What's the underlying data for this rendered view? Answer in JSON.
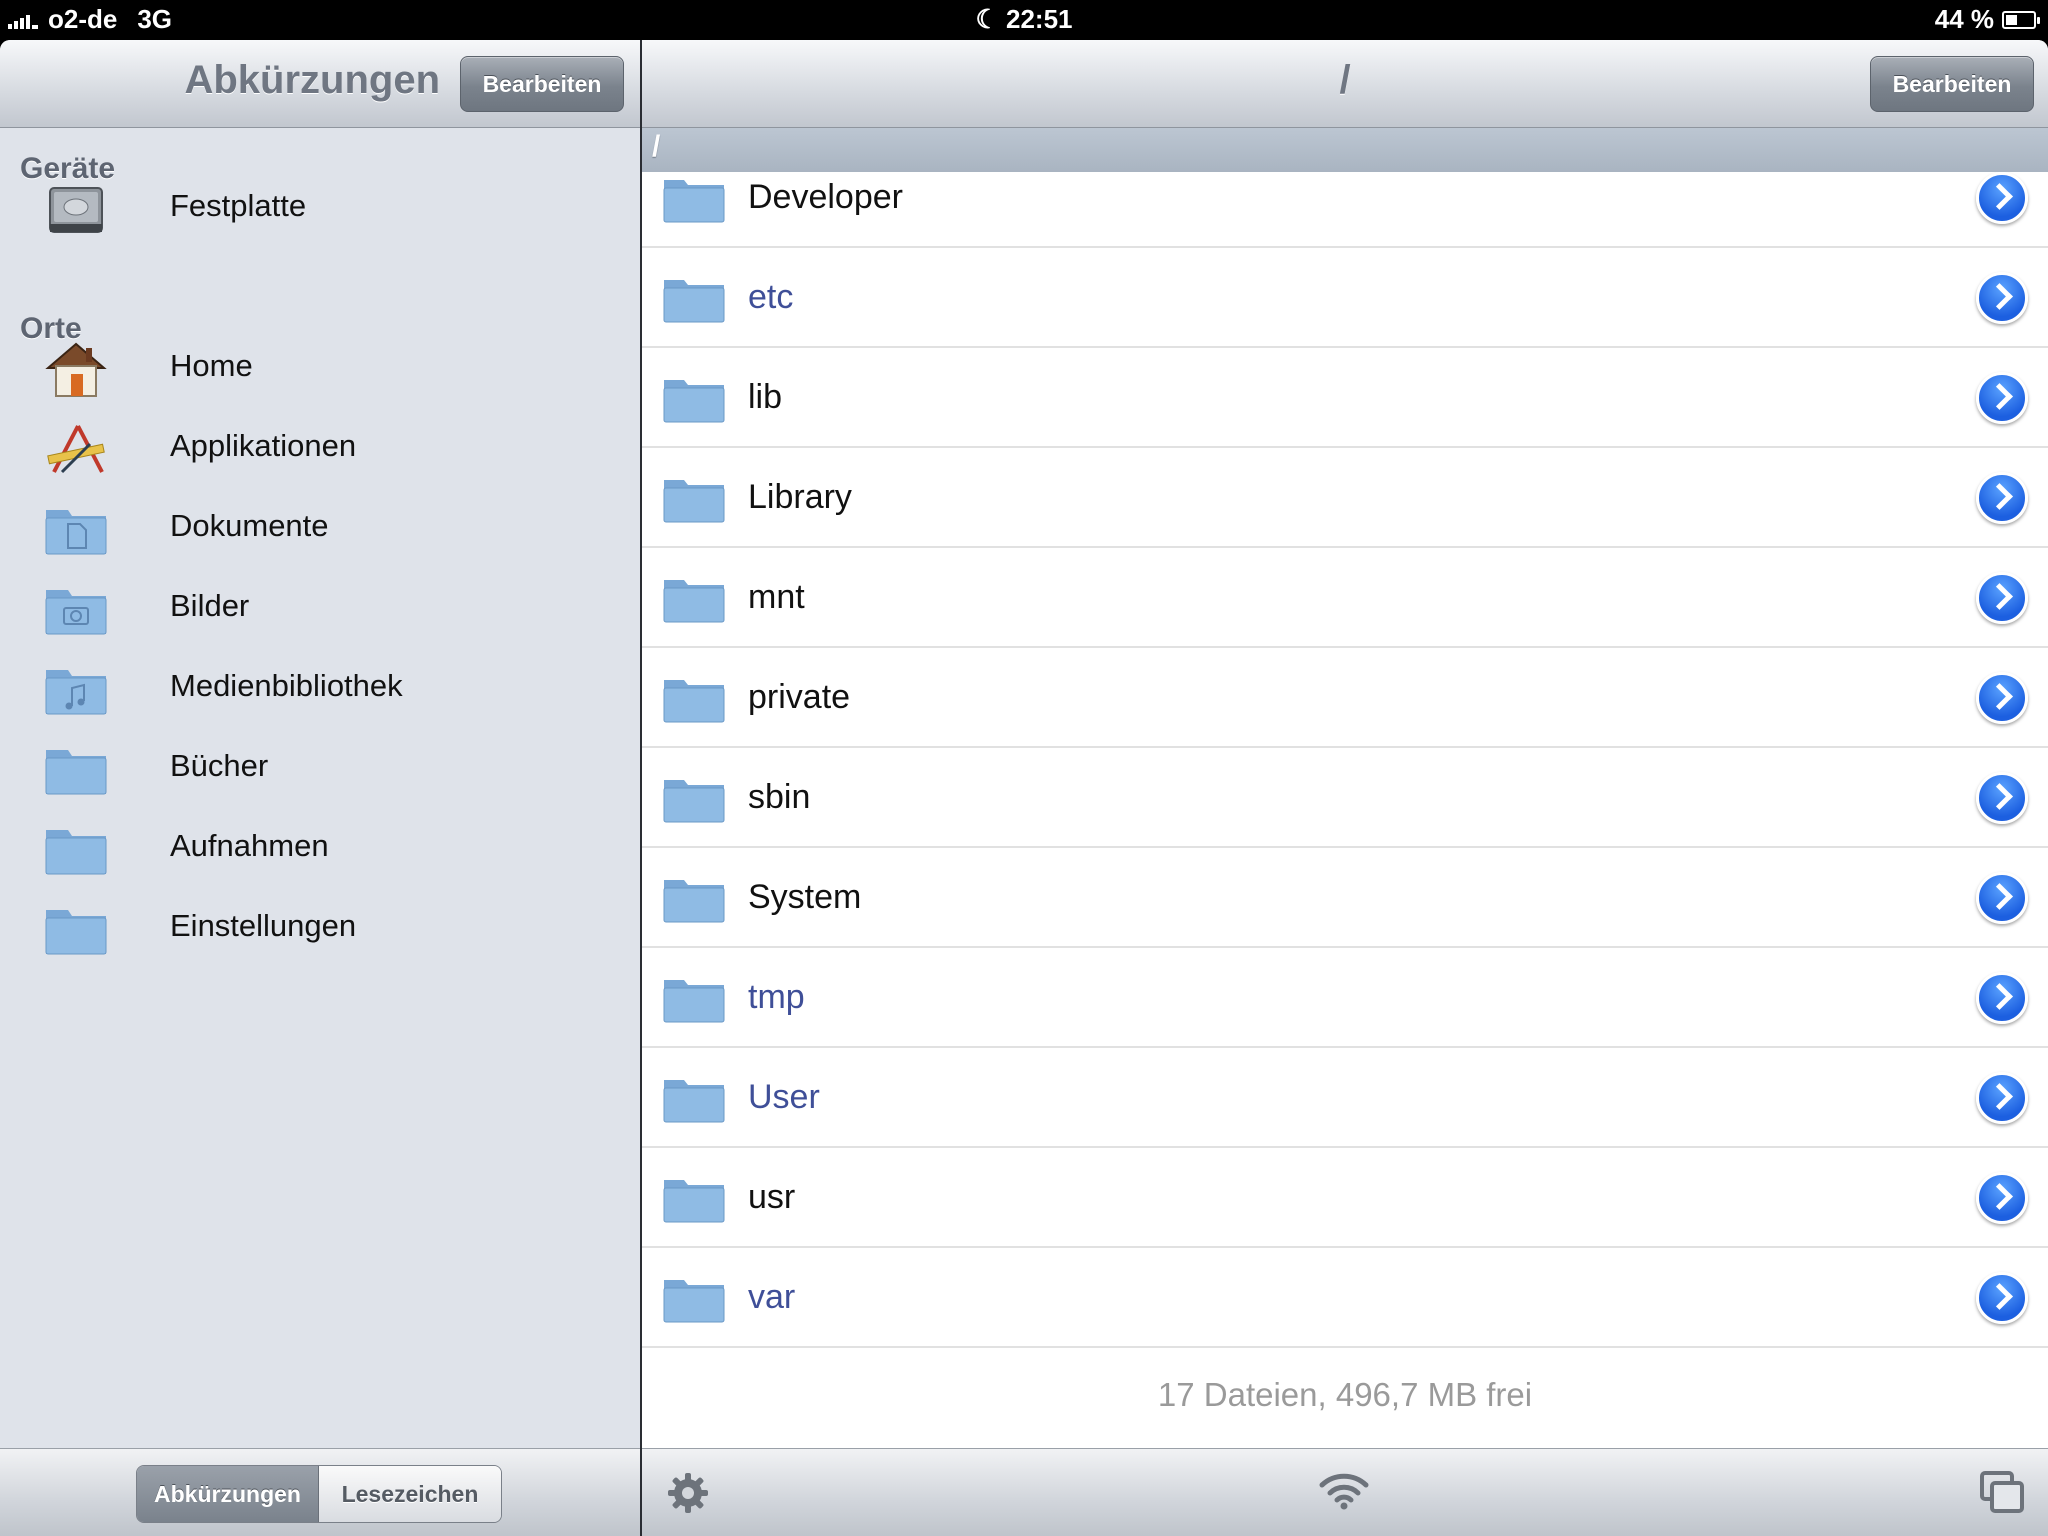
{
  "status_bar": {
    "carrier": "o2-de",
    "network": "3G",
    "time": "22:51",
    "battery": "44 %",
    "battery_level": 0.44
  },
  "sidebar": {
    "title": "Abkürzungen",
    "edit_label": "Bearbeiten",
    "sections": [
      {
        "title": "Geräte",
        "items": [
          {
            "label": "Festplatte",
            "icon": "hard-drive-icon"
          }
        ]
      },
      {
        "title": "Orte",
        "items": [
          {
            "label": "Home",
            "icon": "home-icon"
          },
          {
            "label": "Applikationen",
            "icon": "applications-icon"
          },
          {
            "label": "Dokumente",
            "icon": "documents-folder-icon"
          },
          {
            "label": "Bilder",
            "icon": "pictures-folder-icon"
          },
          {
            "label": "Medienbibliothek",
            "icon": "music-folder-icon"
          },
          {
            "label": "Bücher",
            "icon": "folder-icon"
          },
          {
            "label": "Aufnahmen",
            "icon": "folder-icon"
          },
          {
            "label": "Einstellungen",
            "icon": "folder-icon"
          }
        ]
      }
    ],
    "segmented": {
      "a": "Abkürzungen",
      "b": "Lesezeichen",
      "selected": "Abkürzungen"
    }
  },
  "browser": {
    "title": "/",
    "edit_label": "Bearbeiten",
    "path": "/",
    "files": [
      {
        "name": "Developer",
        "symlink": false
      },
      {
        "name": "etc",
        "symlink": true
      },
      {
        "name": "lib",
        "symlink": false
      },
      {
        "name": "Library",
        "symlink": false
      },
      {
        "name": "mnt",
        "symlink": false
      },
      {
        "name": "private",
        "symlink": false
      },
      {
        "name": "sbin",
        "symlink": false
      },
      {
        "name": "System",
        "symlink": false
      },
      {
        "name": "tmp",
        "symlink": true
      },
      {
        "name": "User",
        "symlink": true
      },
      {
        "name": "usr",
        "symlink": false
      },
      {
        "name": "var",
        "symlink": true
      }
    ],
    "summary": "17 Dateien, 496,7 MB frei",
    "toolbar_icons": [
      "gear-icon",
      "wifi-icon",
      "windows-icon"
    ]
  },
  "colors": {
    "link_text": "#3f4f98",
    "disclosure_blue": "#1c5fe0",
    "sidebar_bg": "#dfe3ea"
  }
}
